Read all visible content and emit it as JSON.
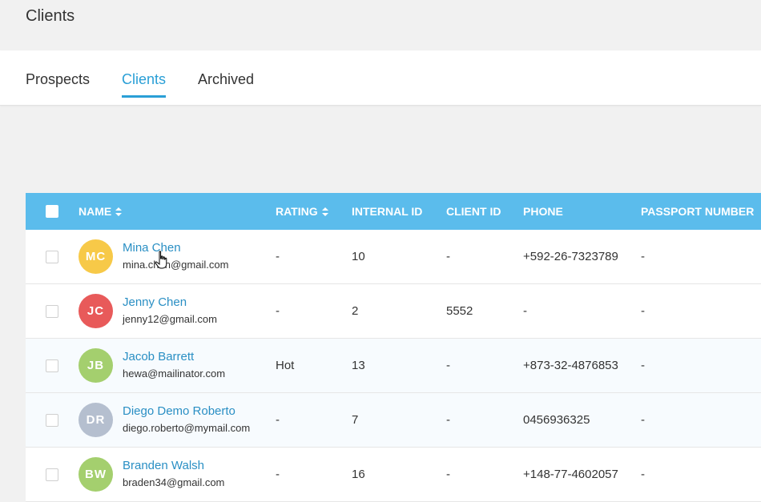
{
  "page": {
    "title": "Clients"
  },
  "tabs": [
    {
      "label": "Prospects",
      "active": false
    },
    {
      "label": "Clients",
      "active": true
    },
    {
      "label": "Archived",
      "active": false
    }
  ],
  "table": {
    "columns": {
      "name": "NAME",
      "rating": "RATING",
      "internal_id": "INTERNAL ID",
      "client_id": "CLIENT ID",
      "phone": "PHONE",
      "passport": "PASSPORT NUMBER"
    },
    "rows": [
      {
        "initials": "MC",
        "avatar_color": "#f7c948",
        "name": "Mina Chen",
        "email": "mina.chen@gmail.com",
        "rating": "-",
        "internal_id": "10",
        "client_id": "-",
        "phone": "+592-26-7323789",
        "passport": "-"
      },
      {
        "initials": "JC",
        "avatar_color": "#e85a5a",
        "name": "Jenny Chen",
        "email": "jenny12@gmail.com",
        "rating": "-",
        "internal_id": "2",
        "client_id": "5552",
        "phone": "-",
        "passport": "-"
      },
      {
        "initials": "JB",
        "avatar_color": "#a4cf6e",
        "name": "Jacob Barrett",
        "email": "hewa@mailinator.com",
        "rating": "Hot",
        "internal_id": "13",
        "client_id": "-",
        "phone": "+873-32-4876853",
        "passport": "-"
      },
      {
        "initials": "DR",
        "avatar_color": "#b5bfcf",
        "name": "Diego Demo Roberto",
        "email": "diego.roberto@mymail.com",
        "rating": "-",
        "internal_id": "7",
        "client_id": "-",
        "phone": "0456936325",
        "passport": "-"
      },
      {
        "initials": "BW",
        "avatar_color": "#a4cf6e",
        "name": "Branden Walsh",
        "email": "braden34@gmail.com",
        "rating": "-",
        "internal_id": "16",
        "client_id": "-",
        "phone": "+148-77-4602057",
        "passport": "-"
      }
    ]
  },
  "colors": {
    "accent": "#2a9fd6",
    "header_bg": "#5bbcec",
    "link": "#2a8fc4"
  },
  "icons": {
    "sort": "sort-icon",
    "cursor": "hand-pointer-icon"
  }
}
